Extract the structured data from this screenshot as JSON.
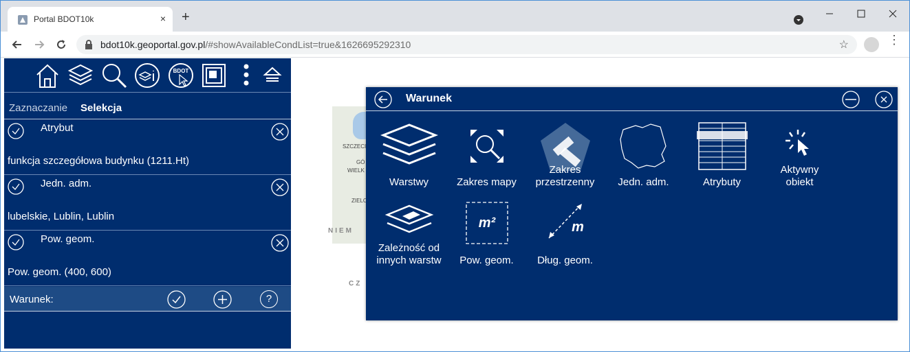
{
  "browser": {
    "tab_title": "Portal BDOT10k",
    "tab_close": "×",
    "new_tab": "+",
    "url_host": "bdot10k.geoportal.gov.pl",
    "url_rest": "/#showAvailableCondList=true&1626695292310"
  },
  "map": {
    "labels": [
      "SZCZECI",
      "GÓ",
      "WIELK",
      "ZIELO",
      "NIEM",
      "CZ"
    ]
  },
  "panel": {
    "toolbar_icons": [
      "home-icon",
      "layers-icon",
      "search-icon",
      "layer-info-icon",
      "bdot-cursor-icon",
      "extent-icon",
      "more-vertical-icon",
      "collapse-icon"
    ],
    "bdot_label": "BDOT",
    "tabs": {
      "zaznaczanie": "Zaznaczanie",
      "selekcja": "Selekcja"
    },
    "conditions": [
      {
        "name": "Atrybut",
        "value": "funkcja szczegółowa budynku (1211.Ht)"
      },
      {
        "name": "Jedn. adm.",
        "value": "lubelskie, Lublin, Lublin"
      },
      {
        "name": "Pow. geom.",
        "value": "Pow. geom. (400, 600)"
      }
    ],
    "warunek_label": "Warunek:",
    "help": "?"
  },
  "dialog": {
    "title": "Warunek",
    "options": [
      {
        "label_line1": "Warstwy",
        "label_line2": ""
      },
      {
        "label_line1": "Zakres mapy",
        "label_line2": ""
      },
      {
        "label_line1": "Zakres",
        "label_line2": "przestrzenny"
      },
      {
        "label_line1": "Jedn. adm.",
        "label_line2": ""
      },
      {
        "label_line1": "Atrybuty",
        "label_line2": ""
      },
      {
        "label_line1": "Aktywny",
        "label_line2": "obiekt"
      },
      {
        "label_line1": "Zależność od",
        "label_line2": "innych warstw"
      },
      {
        "label_line1": "Pow. geom.",
        "label_line2": ""
      },
      {
        "label_line1": "Dług. geom.",
        "label_line2": ""
      }
    ],
    "area_icon_text": "m²",
    "length_icon_text": "m"
  },
  "colors": {
    "panel_bg": "#002d6e",
    "warunek_bar": "#1e4b85",
    "chrome_bg": "#dee1e6"
  }
}
